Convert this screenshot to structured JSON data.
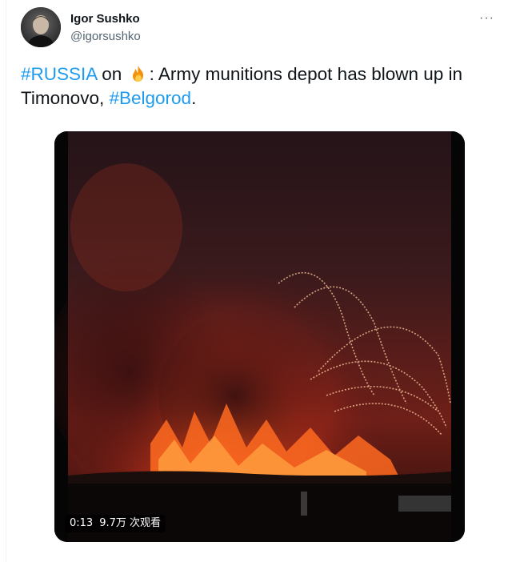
{
  "author": {
    "display_name": "Igor Sushko",
    "handle": "@igorsushko"
  },
  "tweet": {
    "hashtag_russia": "#RUSSIA",
    "text_on": " on ",
    "emoji_name": "fire-emoji",
    "text_main": ": Army munitions depot has blown up in Timonovo, ",
    "hashtag_belgorod": "#Belgorod",
    "text_end": "."
  },
  "menu": {
    "more_label": "···"
  },
  "video": {
    "duration": "0:13",
    "views": "9.7万 次观看"
  },
  "colors": {
    "link": "#1d9bf0",
    "secondary_text": "#536471",
    "primary_text": "#0f1419"
  }
}
